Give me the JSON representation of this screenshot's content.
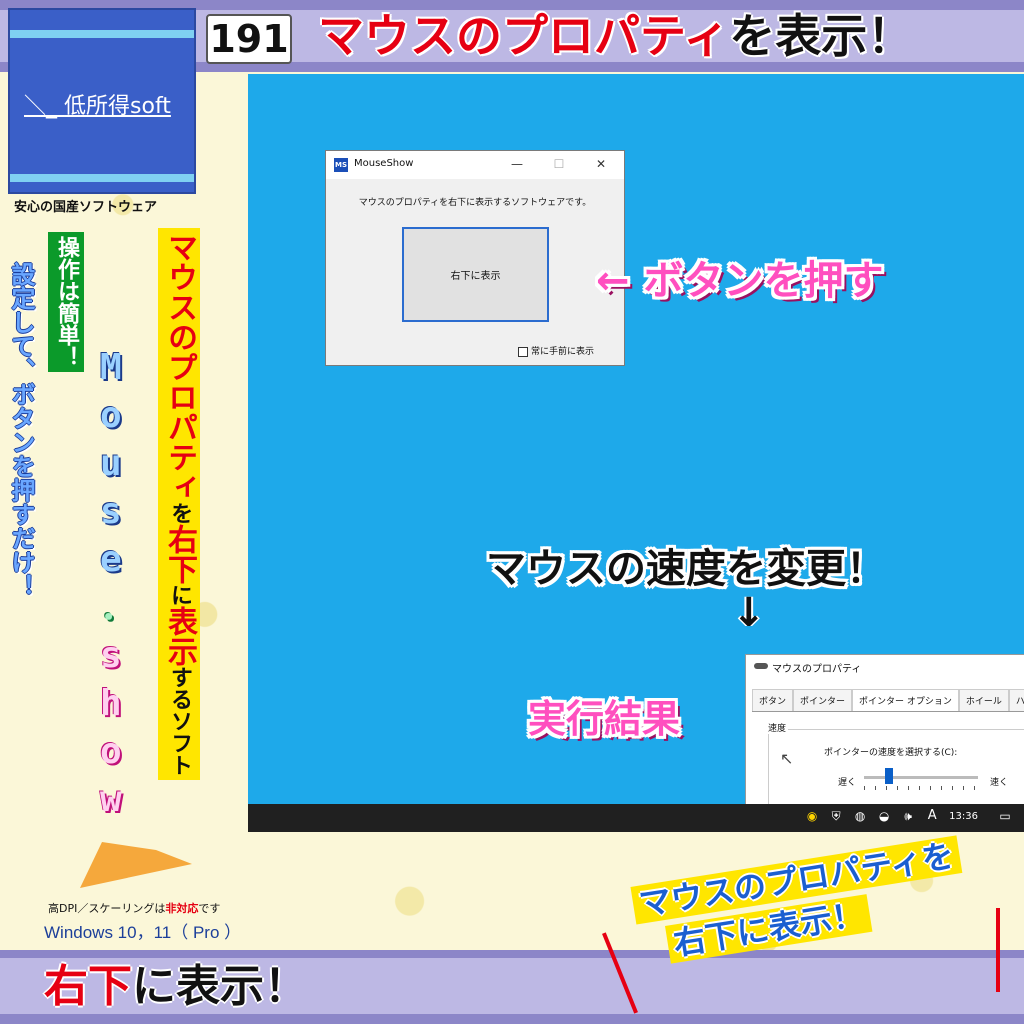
{
  "header": {
    "episode": "191",
    "title_red1": "マウスのプロパティ",
    "title_black": "を表示！"
  },
  "logo": {
    "brand": "低所得soft",
    "brand_mark": "＼_",
    "tagline": "安心の国産ソフトウェア"
  },
  "sidebar": {
    "blue_vertical": "設定して、ボタンを押すだけ！",
    "green_vertical": "操作は簡単！",
    "mouse_letters": [
      "M",
      "o",
      "u",
      "s",
      "e",
      "．",
      "s",
      "h",
      "o",
      "w"
    ],
    "yellow_red1": "マウスのプロパティ",
    "yellow_k1": "を",
    "yellow_red2": "右下",
    "yellow_k2": "に",
    "yellow_red3": "表示",
    "yellow_k3": "するソフト"
  },
  "notes": {
    "dpi_prefix": "高DPI／スケーリングは",
    "dpi_red": "非対応",
    "dpi_suffix": "です",
    "os": "Windows 10，11（ Pro ）"
  },
  "footer": {
    "title_red": "右下",
    "title_black": "に表示！"
  },
  "window": {
    "icon_text": "MS",
    "title": "MouseShow",
    "minimize": "—",
    "maximize": "☐",
    "close": "✕",
    "description": "マウスのプロパティを右下に表示するソフトウェアです。",
    "button_label": "右下に表示",
    "checkbox_label": "常に手前に表示",
    "checkbox_checked": false
  },
  "properties": {
    "title": "マウスのプロパティ",
    "tabs": [
      "ボタン",
      "ポインター",
      "ポインター オプション",
      "ホイール",
      "ハード"
    ],
    "active_tab": 2,
    "group": "速度",
    "label": "ポインターの速度を選択する(C):",
    "slow": "遅く",
    "fast": "速く",
    "speed_fraction": 0.22
  },
  "taskbar": {
    "time": "13:36",
    "ime": "A"
  },
  "captions": {
    "press": "← ボタンを押す",
    "speed": "マウスの速度を変更！",
    "arrow": "↓",
    "result": "実行結果"
  },
  "sticker": {
    "line1": "マウスのプロパティを",
    "line2": "右下に表示！"
  },
  "colors": {
    "desktop": "#1ea9ea",
    "accent_red": "#e60012",
    "caption_pink": "#ff4fbf",
    "logo_blue": "#3a5fc8",
    "bar_purple": "#bdb8e4"
  }
}
